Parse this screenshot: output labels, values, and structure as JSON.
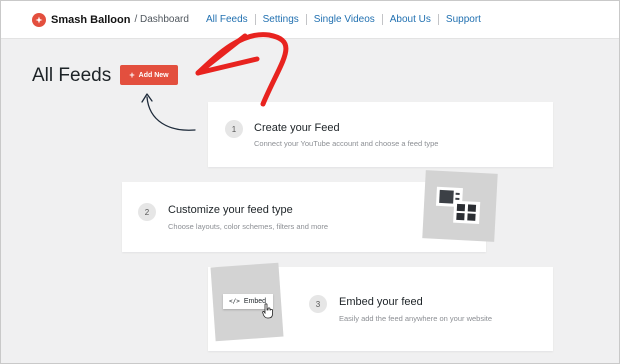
{
  "header": {
    "brand": "Smash Balloon",
    "crumb": "/ Dashboard",
    "nav": [
      "All Feeds",
      "Settings",
      "Single Videos",
      "About Us",
      "Support"
    ]
  },
  "page": {
    "title": "All Feeds",
    "add_button": "Add New"
  },
  "steps": [
    {
      "num": "1",
      "title": "Create your Feed",
      "desc": "Connect your YouTube account and choose a feed type"
    },
    {
      "num": "2",
      "title": "Customize your feed type",
      "desc": "Choose layouts, color schemes, filters and more"
    },
    {
      "num": "3",
      "title": "Embed your feed",
      "desc": "Easily add the feed anywhere on your website"
    }
  ],
  "embed_chip": {
    "code": "</>",
    "label": "Embed"
  },
  "colors": {
    "brand_red": "#e34f3e",
    "link_blue": "#2271b1",
    "annotation_red": "#e8231f"
  }
}
